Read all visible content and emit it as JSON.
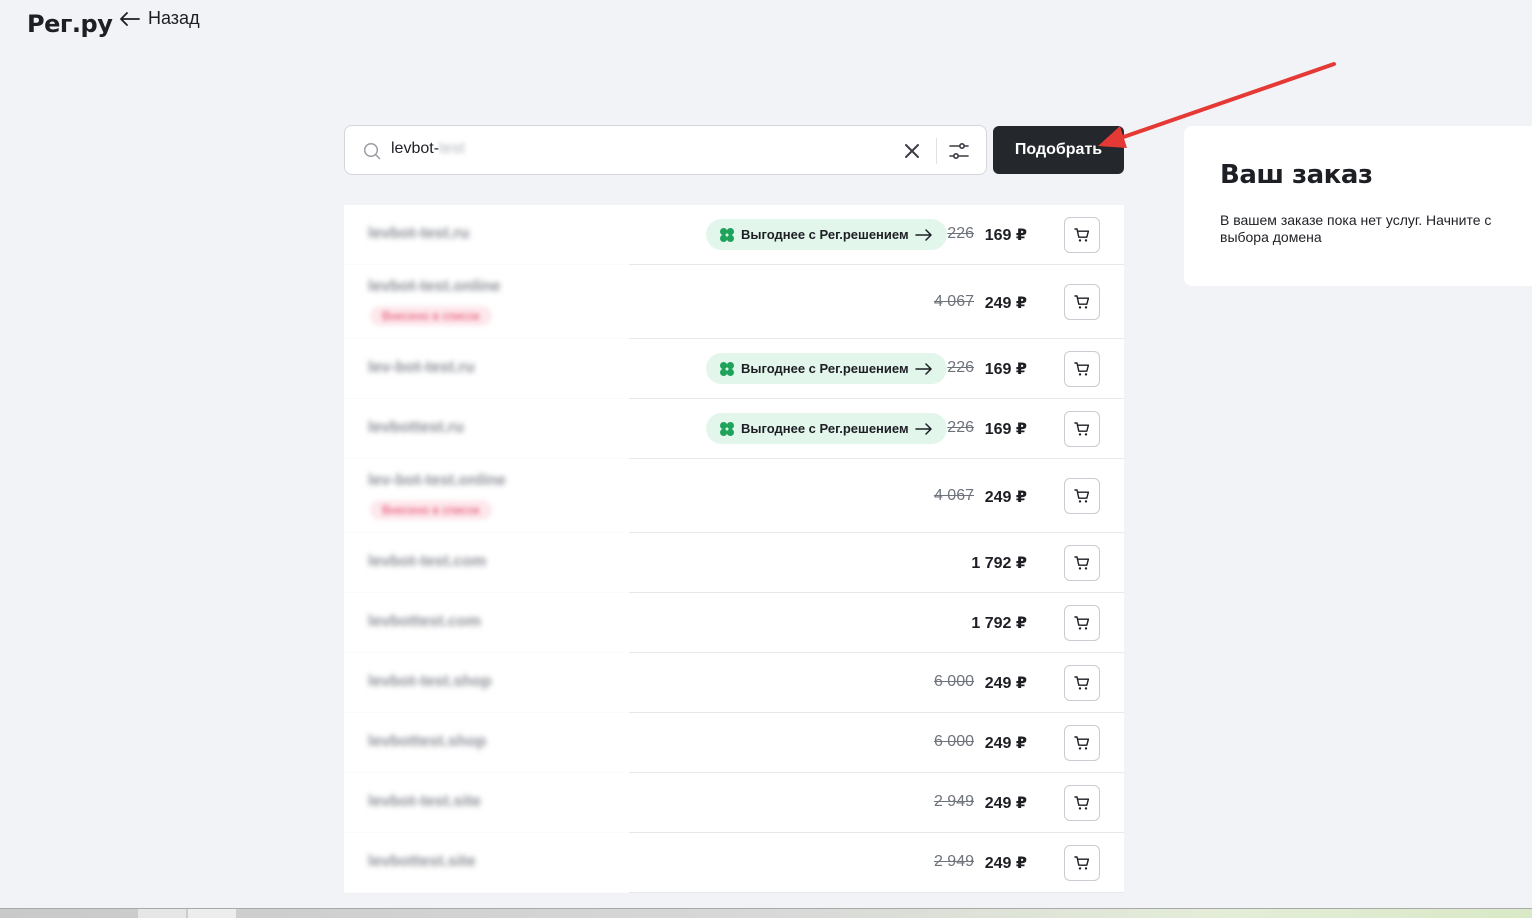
{
  "header": {
    "logo": "Рег.ру",
    "back_label": "Назад"
  },
  "search": {
    "query_visible": "levbot-",
    "query_blurred": "test",
    "submit_label": "Подобрать"
  },
  "order": {
    "title": "Ваш заказ",
    "empty_text": "В вашем заказе пока нет услуг. Начните с выбора домена"
  },
  "promo_label": "Выгоднее с Рег.решением",
  "domains": [
    {
      "name": "levbot-test.ru",
      "tag": "",
      "promo": true,
      "old_price": "226",
      "price": "169 ₽"
    },
    {
      "name": "levbot-test.online",
      "tag": "Внесено в список",
      "promo": false,
      "old_price": "4 067",
      "price": "249 ₽"
    },
    {
      "name": "lev-bot-test.ru",
      "tag": "",
      "promo": true,
      "old_price": "226",
      "price": "169 ₽"
    },
    {
      "name": "levbottest.ru",
      "tag": "",
      "promo": true,
      "old_price": "226",
      "price": "169 ₽"
    },
    {
      "name": "lev-bot-test.online",
      "tag": "Внесено в список",
      "promo": false,
      "old_price": "4 067",
      "price": "249 ₽"
    },
    {
      "name": "levbot-test.com",
      "tag": "",
      "promo": false,
      "old_price": "",
      "price": "1 792 ₽"
    },
    {
      "name": "levbottest.com",
      "tag": "",
      "promo": false,
      "old_price": "",
      "price": "1 792 ₽"
    },
    {
      "name": "levbot-test.shop",
      "tag": "",
      "promo": false,
      "old_price": "6 000",
      "price": "249 ₽"
    },
    {
      "name": "levbottest.shop",
      "tag": "",
      "promo": false,
      "old_price": "6 000",
      "price": "249 ₽"
    },
    {
      "name": "levbot-test.site",
      "tag": "",
      "promo": false,
      "old_price": "2 949",
      "price": "249 ₽"
    },
    {
      "name": "levbottest.site",
      "tag": "",
      "promo": false,
      "old_price": "2 949",
      "price": "249 ₽"
    }
  ],
  "colors": {
    "background": "#f2f3f7",
    "button_dark": "#24272c",
    "promo_bg": "#e3f6ec",
    "promo_icon": "#1fa35a",
    "annotation_arrow": "#e53935"
  },
  "icons": {
    "back": "arrow-left-icon",
    "search": "search-icon",
    "clear": "close-icon",
    "filter": "filter-sliders-icon",
    "promo": "clover-icon",
    "promo_arrow": "arrow-right-icon",
    "cart": "cart-icon"
  }
}
